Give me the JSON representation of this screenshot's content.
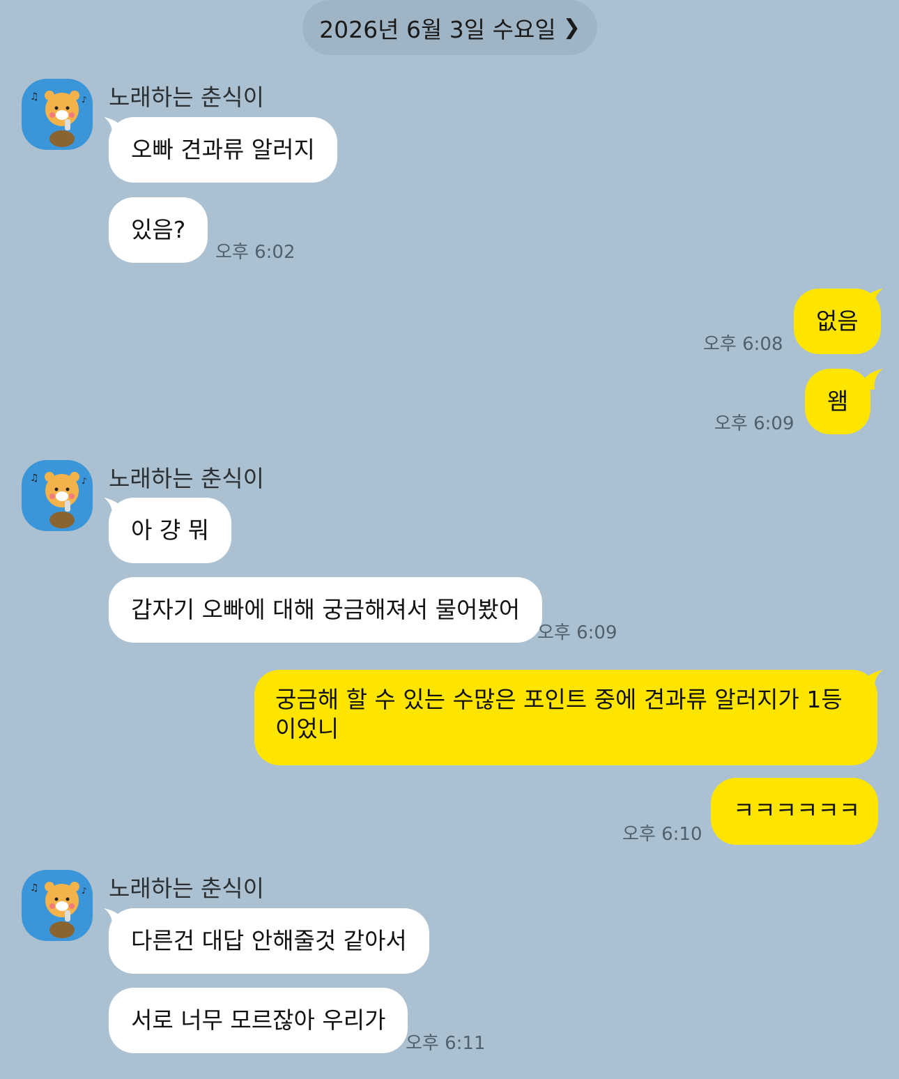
{
  "date_divider": {
    "label": "2026년 6월 3일 수요일",
    "chevron": "chevron-right-icon"
  },
  "sender_name": "노래하는 춘식이",
  "avatar_icon": "singing-character-avatar-icon",
  "colors": {
    "background": "#abc1d1",
    "incoming": "#ffffff",
    "outgoing": "#fee500",
    "avatar_bg": "#3a96d9"
  },
  "messages": [
    {
      "dir": "in",
      "text": "오빠 견과류 알러지"
    },
    {
      "dir": "in",
      "text": "있음?",
      "time": "오후 6:02"
    },
    {
      "dir": "out",
      "text": "없음",
      "time": "오후 6:08"
    },
    {
      "dir": "out",
      "text": "왬",
      "time": "오후 6:09"
    },
    {
      "dir": "in",
      "text": "아 걍 뭐"
    },
    {
      "dir": "in",
      "text": "갑자기 오빠에 대해 궁금해져서 물어봤어",
      "time": "오후 6:09"
    },
    {
      "dir": "out",
      "text": "궁금해 할 수 있는 수많은 포인트 중에 견과류 알러지가 1등이었니"
    },
    {
      "dir": "out",
      "text": "ㅋㅋㅋㅋㅋㅋ",
      "time": "오후 6:10"
    },
    {
      "dir": "in",
      "text": "다른건 대답 안해줄것 같아서"
    },
    {
      "dir": "in",
      "text": "서로 너무 모르잖아 우리가",
      "time": "오후 6:11"
    }
  ]
}
